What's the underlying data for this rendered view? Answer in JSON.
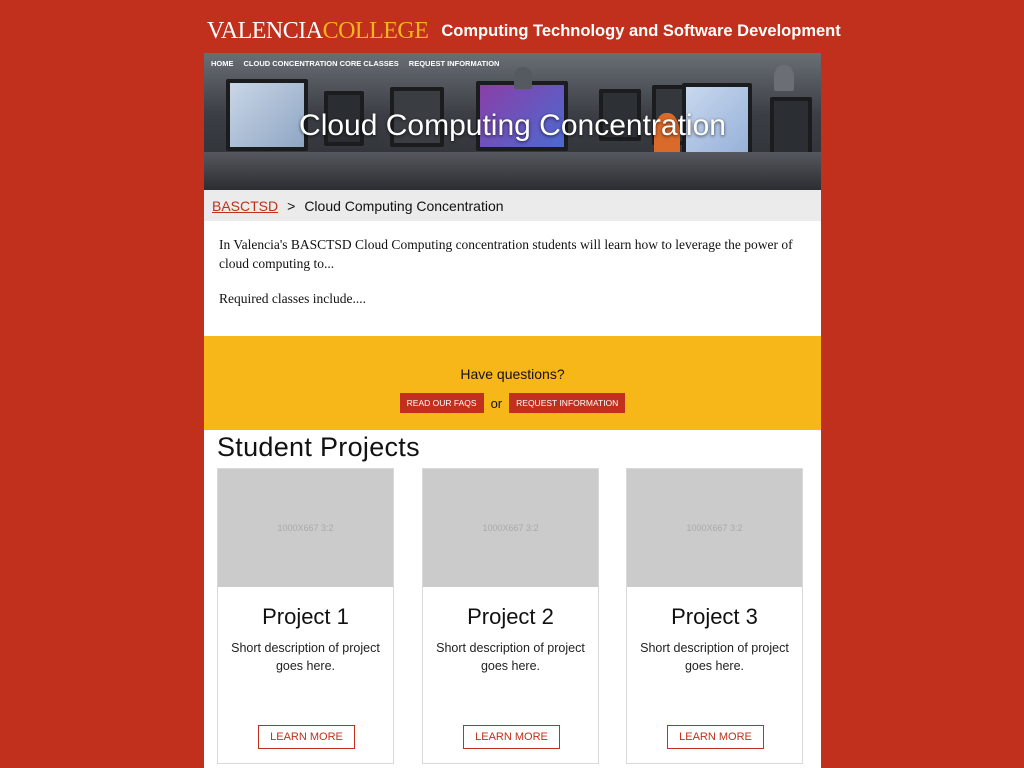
{
  "header": {
    "logo_part1": "VALENCIA",
    "logo_part2": "COLLEGE",
    "site_title": "Computing Technology and Software Development"
  },
  "nav": {
    "items": [
      {
        "label": "HOME"
      },
      {
        "label": "CLOUD CONCENTRATION CORE CLASSES"
      },
      {
        "label": "REQUEST INFORMATION"
      }
    ]
  },
  "hero": {
    "title": "Cloud Computing Concentration"
  },
  "breadcrumb": {
    "parent_label": "BASCTSD",
    "separator": ">",
    "current_label": "Cloud Computing Concentration"
  },
  "intro": {
    "paragraph1": "In Valencia's BASCTSD Cloud Computing concentration students will learn how to leverage the power of cloud computing to...",
    "paragraph2": "Required classes include...."
  },
  "cta": {
    "question": "Have questions?",
    "faq_label": "READ OUR FAQS",
    "or_text": "or",
    "request_label": "REQUEST INFORMATION"
  },
  "projects": {
    "heading": "Student Projects",
    "items": [
      {
        "placeholder": "1000X667 3:2",
        "title": "Project 1",
        "description": "Short description of project goes here.",
        "button_label": "LEARN MORE"
      },
      {
        "placeholder": "1000X667 3:2",
        "title": "Project 2",
        "description": "Short description of project goes here.",
        "button_label": "LEARN MORE"
      },
      {
        "placeholder": "1000X667 3:2",
        "title": "Project 3",
        "description": "Short description of project goes here.",
        "button_label": "LEARN MORE"
      }
    ]
  },
  "colors": {
    "brand_red": "#c0301c",
    "brand_gold": "#f8b718",
    "white": "#ffffff"
  }
}
